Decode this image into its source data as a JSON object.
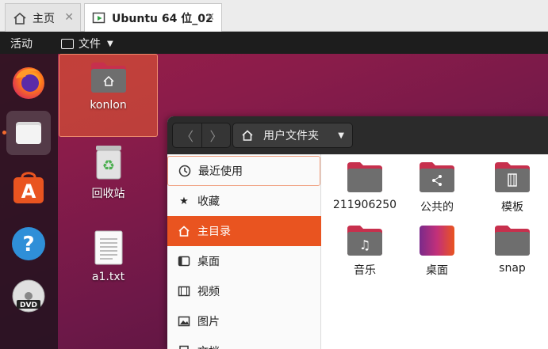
{
  "tabs": [
    {
      "label": "主页"
    },
    {
      "label": "Ubuntu 64 位_02"
    }
  ],
  "topbar": {
    "activities": "活动",
    "app_menu": "文件"
  },
  "desktop_icons": [
    {
      "label": "konlon"
    },
    {
      "label": "回收站"
    },
    {
      "label": "a1.txt"
    }
  ],
  "dock": [
    "firefox-icon",
    "files-icon",
    "software-icon",
    "help-icon",
    "dvd-icon"
  ],
  "files_window": {
    "path_label": "用户文件夹",
    "sidebar": [
      {
        "label": "最近使用",
        "icon": "clock-icon"
      },
      {
        "label": "收藏",
        "icon": "star-icon"
      },
      {
        "label": "主目录",
        "icon": "home-icon"
      },
      {
        "label": "桌面",
        "icon": "desktop-icon"
      },
      {
        "label": "视频",
        "icon": "film-icon"
      },
      {
        "label": "图片",
        "icon": "image-icon"
      },
      {
        "label": "文档",
        "icon": "document-icon"
      }
    ],
    "folders": [
      {
        "label": "211906250"
      },
      {
        "label": "公共的"
      },
      {
        "label": "模板"
      },
      {
        "label": "音乐"
      },
      {
        "label": "桌面"
      },
      {
        "label": "snap"
      }
    ]
  },
  "colors": {
    "accent": "#e95420",
    "folder": "#6e6e6e",
    "folder_tab": "#c7304d"
  }
}
